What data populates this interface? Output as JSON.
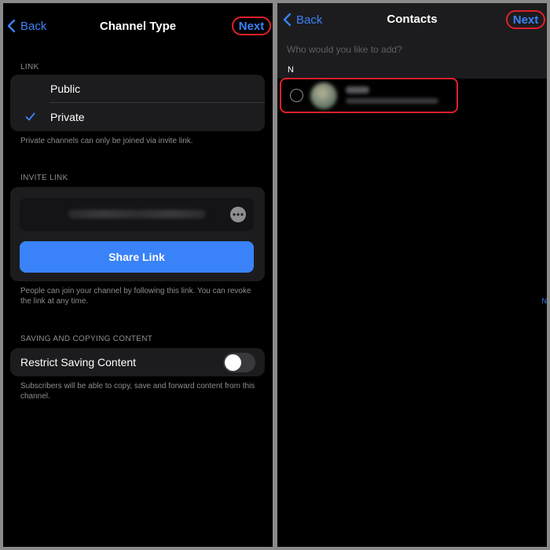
{
  "left": {
    "nav": {
      "back": "Back",
      "title": "Channel Type",
      "next": "Next"
    },
    "link_section": {
      "label": "LINK",
      "options": [
        {
          "label": "Public",
          "selected": false
        },
        {
          "label": "Private",
          "selected": true
        }
      ],
      "footnote": "Private channels can only be joined via invite link."
    },
    "invite_section": {
      "label": "INVITE LINK",
      "share_button": "Share Link",
      "footnote": "People can join your channel by following this link. You can revoke the link at any time."
    },
    "saving_section": {
      "label": "SAVING AND COPYING CONTENT",
      "toggle_label": "Restrict Saving Content",
      "toggle_on": false,
      "footnote": "Subscribers will be able to copy, save and forward content from this channel."
    }
  },
  "right": {
    "nav": {
      "back": "Back",
      "title": "Contacts",
      "next": "Next"
    },
    "search": {
      "placeholder": "Who would you like to add?"
    },
    "section_header": "N",
    "index_letter": "N"
  },
  "colors": {
    "accent": "#3a82f7",
    "highlight": "#e0202a",
    "cell": "#1c1c1e"
  }
}
